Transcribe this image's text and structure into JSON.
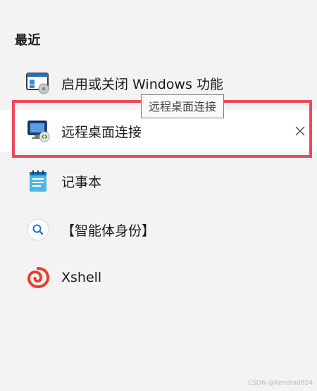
{
  "section": {
    "title": "最近"
  },
  "items": [
    {
      "label": "启用或关闭 Windows 功能",
      "icon": "windows-features-icon"
    },
    {
      "label": "远程桌面连接",
      "icon": "remote-desktop-icon"
    },
    {
      "label": "记事本",
      "icon": "notepad-icon"
    },
    {
      "label": "【智能体身份】",
      "icon": "search-icon"
    },
    {
      "label": "Xshell",
      "icon": "xshell-icon"
    }
  ],
  "tooltip": {
    "text": "远程桌面连接"
  },
  "close": {
    "icon": "close-icon"
  },
  "watermark": {
    "text": "CSDN @Kendra0824"
  },
  "colors": {
    "highlight_border": "#f0485a",
    "background": "#f3f3f3",
    "row_highlight": "#ffffff"
  }
}
